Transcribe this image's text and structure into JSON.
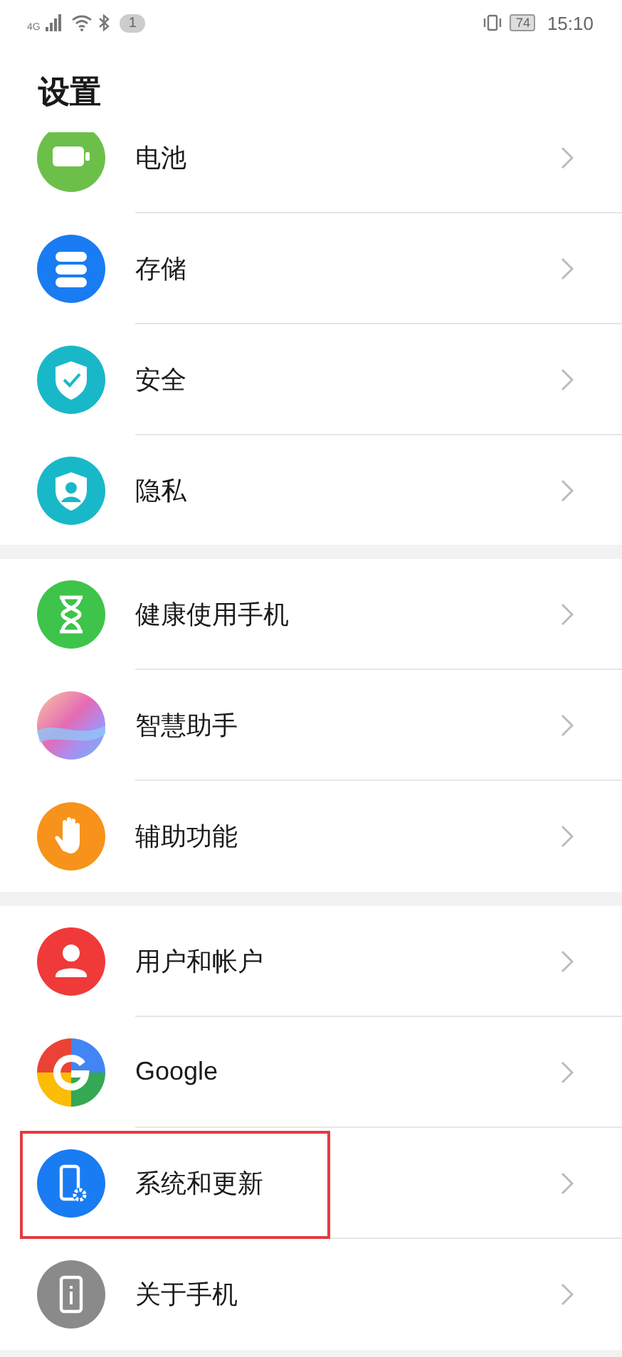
{
  "status_bar": {
    "network": "4G",
    "notification_count": "1",
    "battery": "74",
    "time": "15:10"
  },
  "title": "设置",
  "groups": [
    {
      "items": [
        {
          "label": "电池",
          "kind": "battery",
          "highlighted": false
        },
        {
          "label": "存储",
          "kind": "storage",
          "highlighted": false
        },
        {
          "label": "安全",
          "kind": "security",
          "highlighted": false
        },
        {
          "label": "隐私",
          "kind": "privacy",
          "highlighted": false
        }
      ]
    },
    {
      "items": [
        {
          "label": "健康使用手机",
          "kind": "hourglass",
          "highlighted": false
        },
        {
          "label": "智慧助手",
          "kind": "assistant",
          "highlighted": false
        },
        {
          "label": "辅助功能",
          "kind": "hand",
          "highlighted": false
        }
      ]
    },
    {
      "items": [
        {
          "label": "用户和帐户",
          "kind": "user",
          "highlighted": false
        },
        {
          "label": "Google",
          "kind": "google",
          "highlighted": false
        },
        {
          "label": "系统和更新",
          "kind": "system",
          "highlighted": true
        },
        {
          "label": "关于手机",
          "kind": "about",
          "highlighted": false
        }
      ]
    }
  ]
}
